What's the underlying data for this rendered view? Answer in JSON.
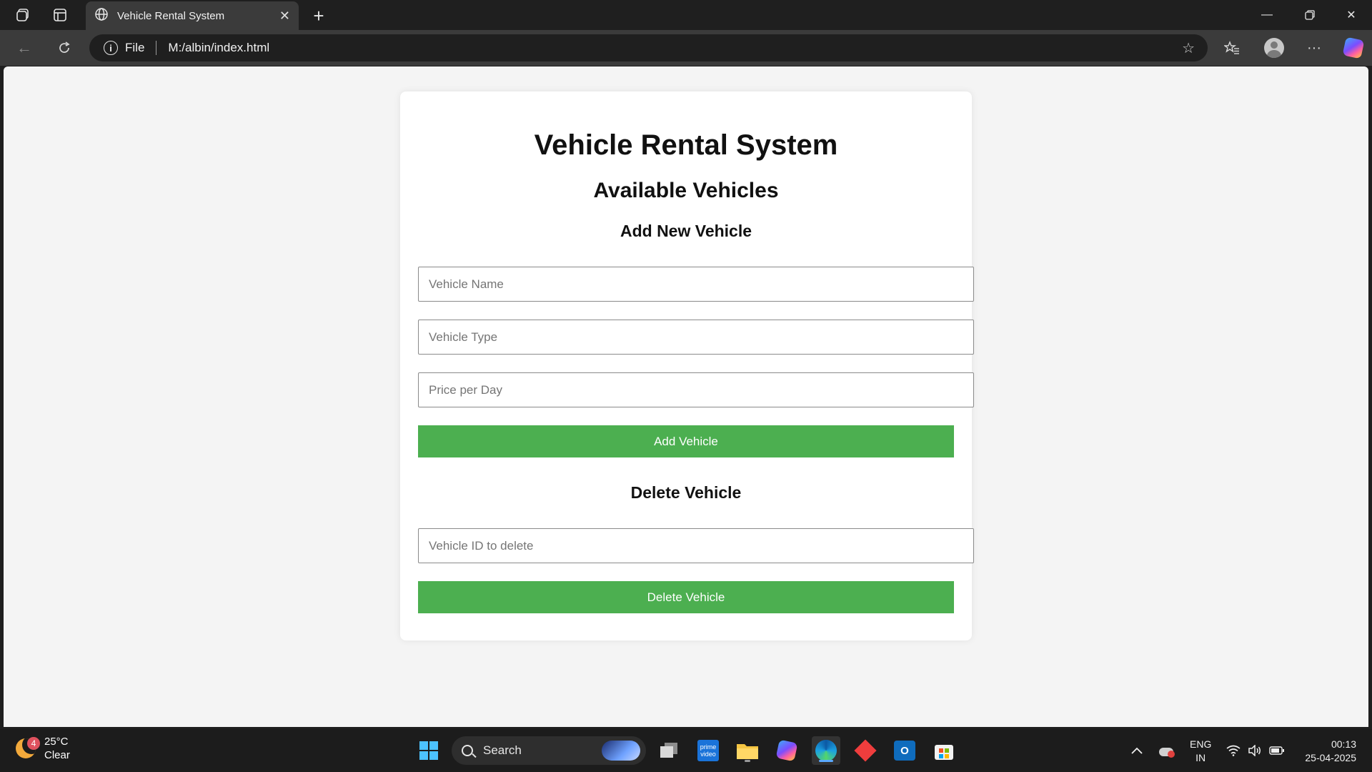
{
  "browser": {
    "tab_title": "Vehicle Rental System",
    "address_scheme": "File",
    "address_url": "M:/albin/index.html"
  },
  "page": {
    "title": "Vehicle Rental System",
    "available_heading": "Available Vehicles",
    "add_heading": "Add New Vehicle",
    "vehicle_name_placeholder": "Vehicle Name",
    "vehicle_type_placeholder": "Vehicle Type",
    "price_placeholder": "Price per Day",
    "add_button": "Add Vehicle",
    "delete_heading": "Delete Vehicle",
    "delete_id_placeholder": "Vehicle ID to delete",
    "delete_button": "Delete Vehicle",
    "accent_color": "#4caf50"
  },
  "taskbar": {
    "weather_badge": "4",
    "temperature": "25°C",
    "condition": "Clear",
    "search_label": "Search",
    "language": "ENG",
    "region": "IN",
    "time": "00:13",
    "date": "25-04-2025"
  }
}
